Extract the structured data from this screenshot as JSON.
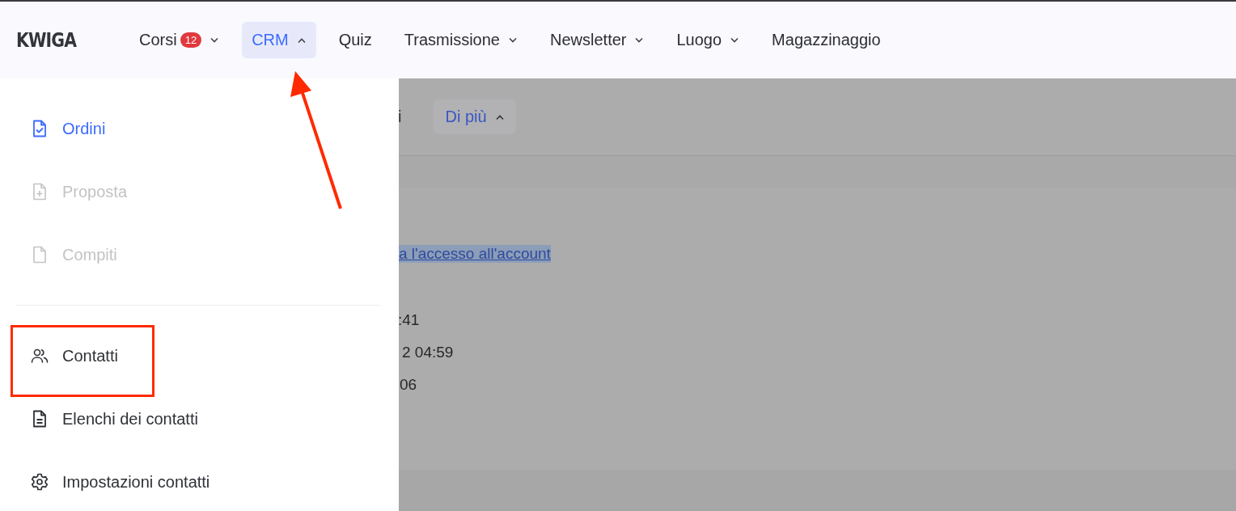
{
  "header": {
    "logo": "KWIGA",
    "nav": [
      {
        "label": "Corsi",
        "badge": "12",
        "kind": "dropdown",
        "selected": false,
        "expanded": false
      },
      {
        "label": "CRM",
        "kind": "dropdown",
        "selected": true,
        "expanded": true
      },
      {
        "label": "Quiz",
        "kind": "link",
        "selected": false
      },
      {
        "label": "Trasmissione",
        "kind": "dropdown",
        "selected": false,
        "expanded": false
      },
      {
        "label": "Newsletter",
        "kind": "dropdown",
        "selected": false,
        "expanded": false
      },
      {
        "label": "Luogo",
        "kind": "dropdown",
        "selected": false,
        "expanded": false
      },
      {
        "label": "Magazzinaggio",
        "kind": "link",
        "selected": false
      }
    ]
  },
  "crm_menu": {
    "groups": [
      [
        {
          "label": "Ordini",
          "selected": true,
          "disabled": false
        },
        {
          "label": "Proposta",
          "selected": false,
          "disabled": true
        },
        {
          "label": "Compiti",
          "selected": false,
          "disabled": true
        }
      ],
      [
        {
          "label": "Contatti",
          "selected": false,
          "disabled": false
        },
        {
          "label": "Elenchi dei contatti",
          "selected": false,
          "disabled": false
        },
        {
          "label": "Impostazioni contatti",
          "selected": false,
          "disabled": false
        }
      ]
    ]
  },
  "background_page": {
    "tab_fragment": "i",
    "more_button": {
      "label": "Di più",
      "expanded": true
    },
    "link_fragment": "a l'accesso all'account",
    "lines": [
      ":41",
      "2 04:59",
      "06"
    ]
  }
}
